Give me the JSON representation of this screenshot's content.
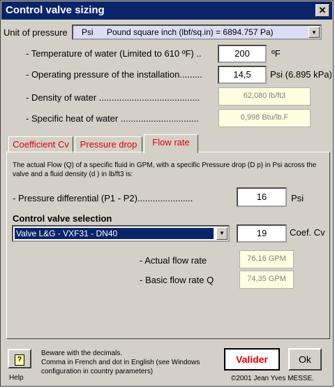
{
  "window": {
    "title": "Control valve sizing",
    "close_label": "✕"
  },
  "unit": {
    "label": "Unit of pressure",
    "code": "Psi",
    "description": "Pound square inch (lbf/sq.in) = 6894.757 Pa)"
  },
  "fields": {
    "temperature": {
      "label": "- Temperature of water (Limited to 610 ºF) ..",
      "value": "200",
      "unit": "ºF"
    },
    "pressure": {
      "label": "- Operating pressure of the installation.........",
      "value": "14,5",
      "unit": "Psi (6.895 kPa)"
    },
    "density": {
      "label": "- Density of water ........................................",
      "value": "62,080 lb/ft3"
    },
    "specific_heat": {
      "label": "- Specific heat of water ...............................",
      "value": "0,998 Btu/lb.F"
    }
  },
  "tabs": [
    {
      "label": "Coefficient Cv"
    },
    {
      "label": "Pressure drop"
    },
    {
      "label": "Flow rate"
    }
  ],
  "flow": {
    "description": "The actual Flow (Q) of a specific fluid in GPM, with a specific Pressure drop (D p) in Psi across the valve and a fluid density (d ) in lb/ft3 is:",
    "pressure_diff_label": "-  Pressure differential (P1 - P2)......................",
    "pressure_diff_value": "16",
    "pressure_diff_unit": "Psi",
    "valve_section_title": "Control valve selection",
    "valve_selected": "Valve L&G - VXF31 - DN40",
    "cv_value": "19",
    "cv_unit": "Coef. Cv",
    "actual_flow_label": "- Actual flow rate",
    "actual_flow_value": "76,16 GPM",
    "basic_flow_label": "- Basic flow rate Q",
    "basic_flow_value": "74,35 GPM"
  },
  "footer": {
    "help_icon": "?",
    "help_label": "Help",
    "notes": [
      "Beware with the decimals.",
      "Comma in French and dot in English (see Windows",
      "configuration in country parameters)"
    ],
    "validate_label": "Valider",
    "ok_label": "Ok",
    "copyright": "©2001 Jean Yves MESSE."
  },
  "colors": {
    "title_bg": "#0a246a",
    "tab_text": "#e00000",
    "selection_bg": "#0a246a",
    "readonly_bg": "#ffffe1"
  }
}
